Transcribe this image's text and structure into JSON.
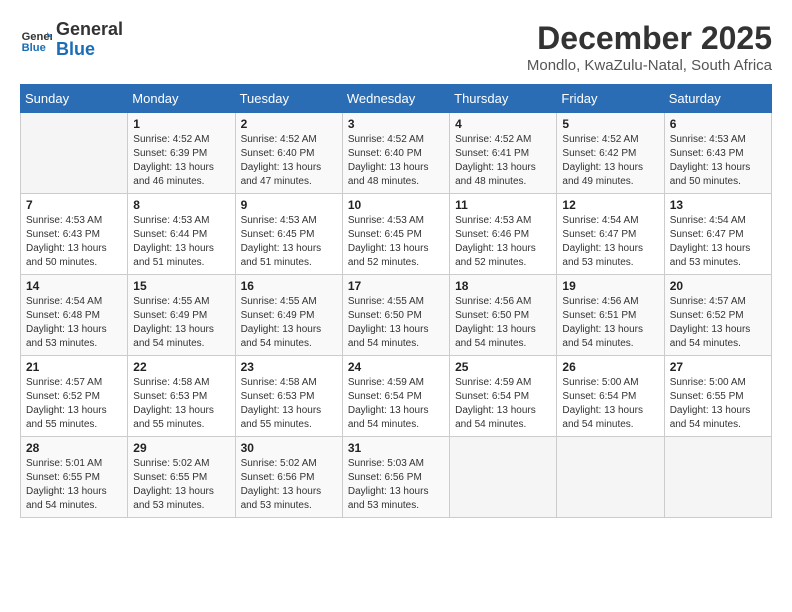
{
  "header": {
    "logo_line1": "General",
    "logo_line2": "Blue",
    "title": "December 2025",
    "subtitle": "Mondlo, KwaZulu-Natal, South Africa"
  },
  "weekdays": [
    "Sunday",
    "Monday",
    "Tuesday",
    "Wednesday",
    "Thursday",
    "Friday",
    "Saturday"
  ],
  "weeks": [
    [
      {
        "day": "",
        "info": ""
      },
      {
        "day": "1",
        "info": "Sunrise: 4:52 AM\nSunset: 6:39 PM\nDaylight: 13 hours\nand 46 minutes."
      },
      {
        "day": "2",
        "info": "Sunrise: 4:52 AM\nSunset: 6:40 PM\nDaylight: 13 hours\nand 47 minutes."
      },
      {
        "day": "3",
        "info": "Sunrise: 4:52 AM\nSunset: 6:40 PM\nDaylight: 13 hours\nand 48 minutes."
      },
      {
        "day": "4",
        "info": "Sunrise: 4:52 AM\nSunset: 6:41 PM\nDaylight: 13 hours\nand 48 minutes."
      },
      {
        "day": "5",
        "info": "Sunrise: 4:52 AM\nSunset: 6:42 PM\nDaylight: 13 hours\nand 49 minutes."
      },
      {
        "day": "6",
        "info": "Sunrise: 4:53 AM\nSunset: 6:43 PM\nDaylight: 13 hours\nand 50 minutes."
      }
    ],
    [
      {
        "day": "7",
        "info": "Sunrise: 4:53 AM\nSunset: 6:43 PM\nDaylight: 13 hours\nand 50 minutes."
      },
      {
        "day": "8",
        "info": "Sunrise: 4:53 AM\nSunset: 6:44 PM\nDaylight: 13 hours\nand 51 minutes."
      },
      {
        "day": "9",
        "info": "Sunrise: 4:53 AM\nSunset: 6:45 PM\nDaylight: 13 hours\nand 51 minutes."
      },
      {
        "day": "10",
        "info": "Sunrise: 4:53 AM\nSunset: 6:45 PM\nDaylight: 13 hours\nand 52 minutes."
      },
      {
        "day": "11",
        "info": "Sunrise: 4:53 AM\nSunset: 6:46 PM\nDaylight: 13 hours\nand 52 minutes."
      },
      {
        "day": "12",
        "info": "Sunrise: 4:54 AM\nSunset: 6:47 PM\nDaylight: 13 hours\nand 53 minutes."
      },
      {
        "day": "13",
        "info": "Sunrise: 4:54 AM\nSunset: 6:47 PM\nDaylight: 13 hours\nand 53 minutes."
      }
    ],
    [
      {
        "day": "14",
        "info": "Sunrise: 4:54 AM\nSunset: 6:48 PM\nDaylight: 13 hours\nand 53 minutes."
      },
      {
        "day": "15",
        "info": "Sunrise: 4:55 AM\nSunset: 6:49 PM\nDaylight: 13 hours\nand 54 minutes."
      },
      {
        "day": "16",
        "info": "Sunrise: 4:55 AM\nSunset: 6:49 PM\nDaylight: 13 hours\nand 54 minutes."
      },
      {
        "day": "17",
        "info": "Sunrise: 4:55 AM\nSunset: 6:50 PM\nDaylight: 13 hours\nand 54 minutes."
      },
      {
        "day": "18",
        "info": "Sunrise: 4:56 AM\nSunset: 6:50 PM\nDaylight: 13 hours\nand 54 minutes."
      },
      {
        "day": "19",
        "info": "Sunrise: 4:56 AM\nSunset: 6:51 PM\nDaylight: 13 hours\nand 54 minutes."
      },
      {
        "day": "20",
        "info": "Sunrise: 4:57 AM\nSunset: 6:52 PM\nDaylight: 13 hours\nand 54 minutes."
      }
    ],
    [
      {
        "day": "21",
        "info": "Sunrise: 4:57 AM\nSunset: 6:52 PM\nDaylight: 13 hours\nand 55 minutes."
      },
      {
        "day": "22",
        "info": "Sunrise: 4:58 AM\nSunset: 6:53 PM\nDaylight: 13 hours\nand 55 minutes."
      },
      {
        "day": "23",
        "info": "Sunrise: 4:58 AM\nSunset: 6:53 PM\nDaylight: 13 hours\nand 55 minutes."
      },
      {
        "day": "24",
        "info": "Sunrise: 4:59 AM\nSunset: 6:54 PM\nDaylight: 13 hours\nand 54 minutes."
      },
      {
        "day": "25",
        "info": "Sunrise: 4:59 AM\nSunset: 6:54 PM\nDaylight: 13 hours\nand 54 minutes."
      },
      {
        "day": "26",
        "info": "Sunrise: 5:00 AM\nSunset: 6:54 PM\nDaylight: 13 hours\nand 54 minutes."
      },
      {
        "day": "27",
        "info": "Sunrise: 5:00 AM\nSunset: 6:55 PM\nDaylight: 13 hours\nand 54 minutes."
      }
    ],
    [
      {
        "day": "28",
        "info": "Sunrise: 5:01 AM\nSunset: 6:55 PM\nDaylight: 13 hours\nand 54 minutes."
      },
      {
        "day": "29",
        "info": "Sunrise: 5:02 AM\nSunset: 6:55 PM\nDaylight: 13 hours\nand 53 minutes."
      },
      {
        "day": "30",
        "info": "Sunrise: 5:02 AM\nSunset: 6:56 PM\nDaylight: 13 hours\nand 53 minutes."
      },
      {
        "day": "31",
        "info": "Sunrise: 5:03 AM\nSunset: 6:56 PM\nDaylight: 13 hours\nand 53 minutes."
      },
      {
        "day": "",
        "info": ""
      },
      {
        "day": "",
        "info": ""
      },
      {
        "day": "",
        "info": ""
      }
    ]
  ]
}
